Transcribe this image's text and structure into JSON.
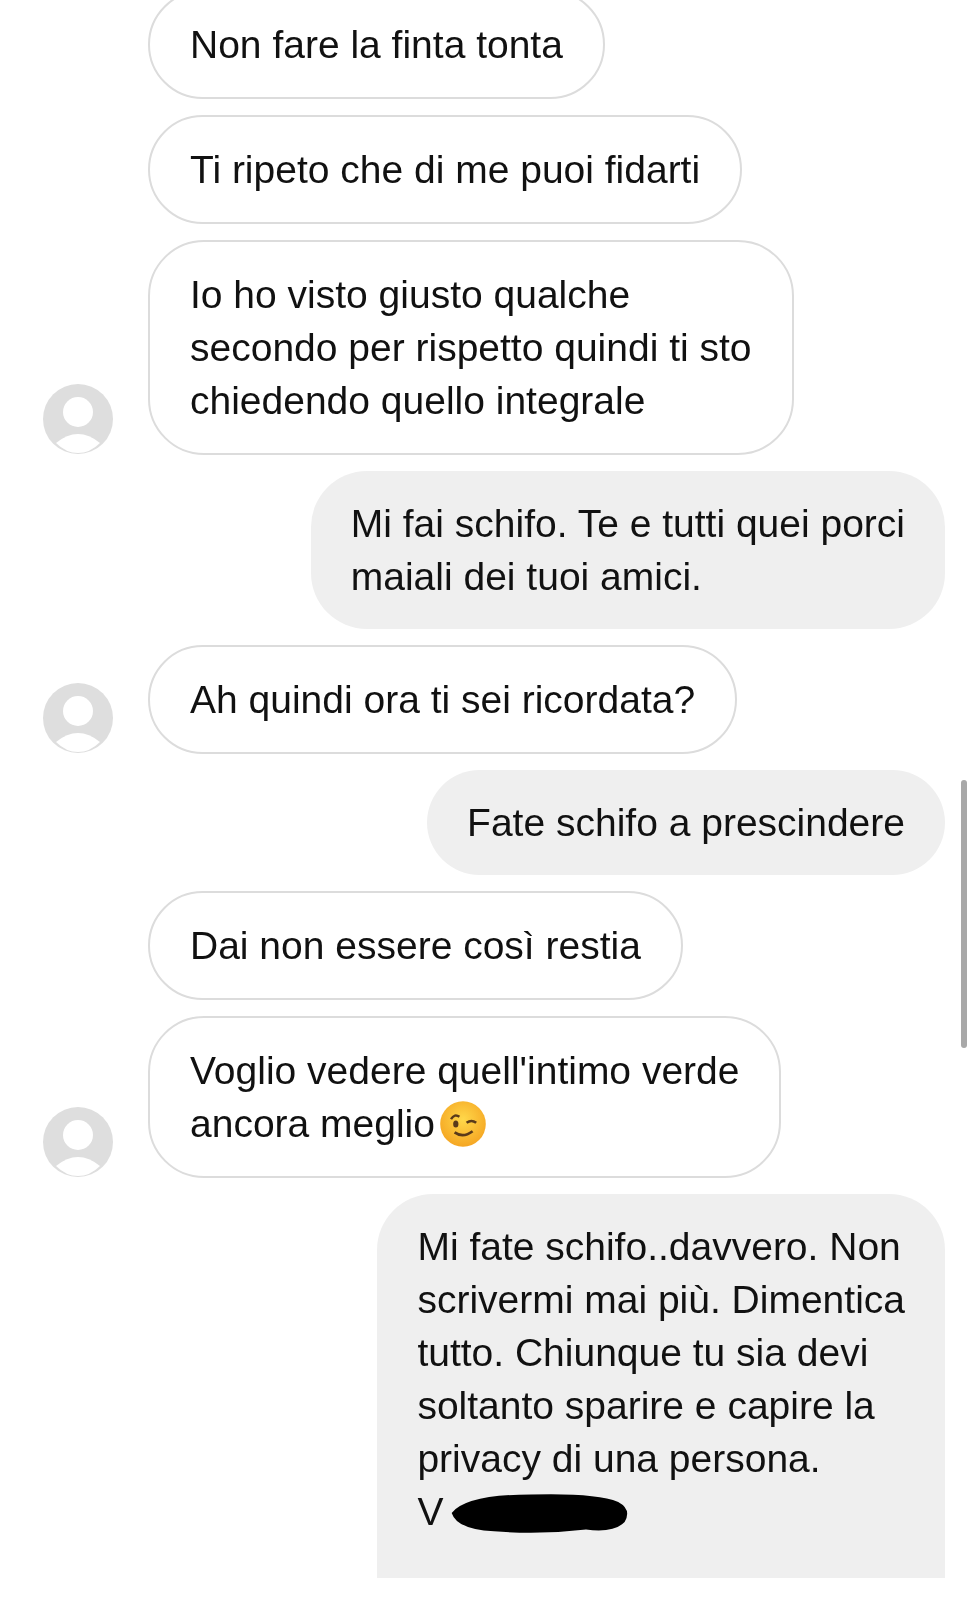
{
  "messages": [
    {
      "kind": "incoming",
      "lines": [
        "Non fare la finta tonta"
      ],
      "show_avatar": false
    },
    {
      "kind": "incoming",
      "lines": [
        "Ti ripeto che di me puoi fidarti"
      ],
      "show_avatar": false
    },
    {
      "kind": "incoming",
      "lines": [
        "Io ho visto giusto qualche",
        "secondo per rispetto quindi ti sto",
        "chiedendo quello integrale"
      ],
      "show_avatar": true
    },
    {
      "kind": "outgoing",
      "lines": [
        "Mi fai schifo. Te e tutti quei porci",
        "maiali dei tuoi amici."
      ]
    },
    {
      "kind": "incoming",
      "lines": [
        "Ah quindi ora ti sei ricordata?"
      ],
      "show_avatar": true
    },
    {
      "kind": "outgoing",
      "lines": [
        "Fate schifo a prescindere"
      ]
    },
    {
      "kind": "incoming",
      "lines": [
        "Dai non essere così restia"
      ],
      "show_avatar": false
    },
    {
      "kind": "incoming",
      "lines": [
        "Voglio vedere quell'intimo verde",
        "ancora meglio"
      ],
      "show_avatar": true,
      "emoji": true
    },
    {
      "kind": "outgoing",
      "lines": [
        "Mi fate schifo..davvero. Non",
        "scrivermi mai più. Dimentica",
        "tutto. Chiunque tu sia devi",
        "soltanto sparire e capire la",
        "privacy di una persona."
      ],
      "signature": "V",
      "signature_redacted": true
    }
  ]
}
